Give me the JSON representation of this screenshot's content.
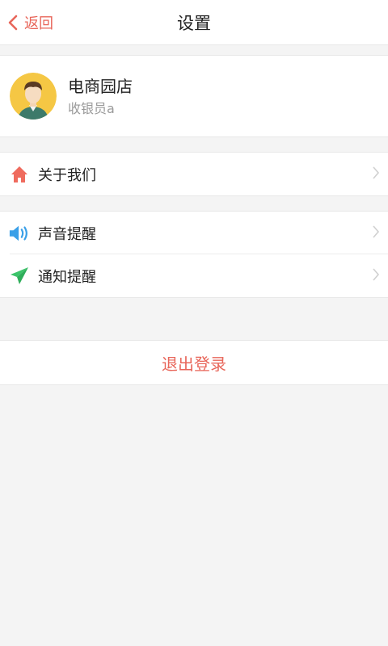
{
  "header": {
    "back_label": "返回",
    "title": "设置"
  },
  "profile": {
    "store_name": "电商园店",
    "role": "收银员a"
  },
  "menu": {
    "about": "关于我们",
    "sound": "声音提醒",
    "notify": "通知提醒"
  },
  "logout_label": "退出登录",
  "colors": {
    "accent": "#e8665a",
    "home_icon": "#ef6b5e",
    "sound_icon": "#3aa0e8",
    "notify_icon": "#3cc46a"
  },
  "icons": {
    "back": "chevron-left-icon",
    "about": "home-icon",
    "sound": "speaker-icon",
    "notify": "paper-plane-icon",
    "arrow": "chevron-right-icon"
  }
}
